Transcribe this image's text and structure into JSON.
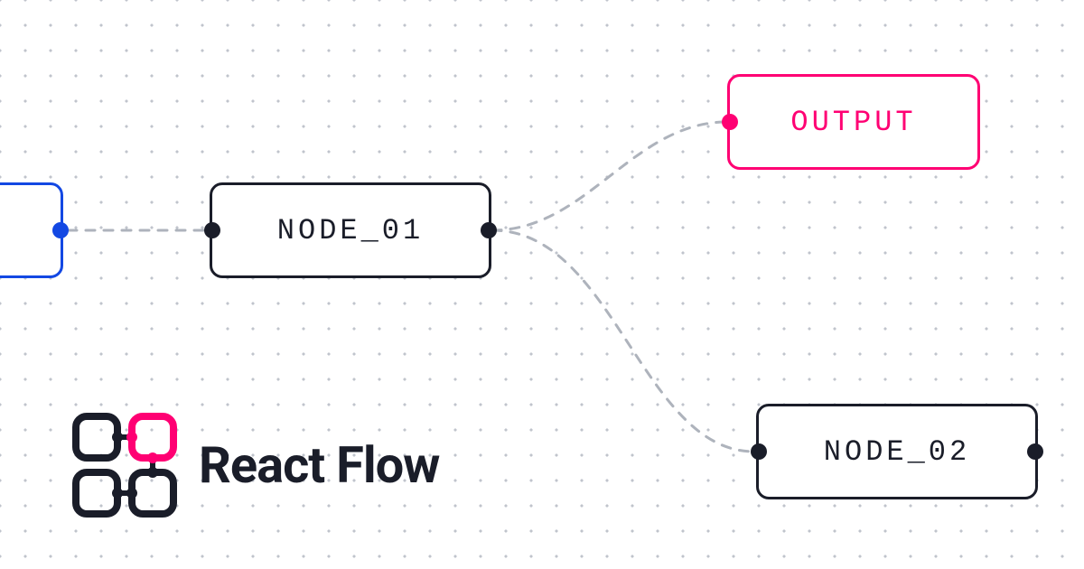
{
  "brand": {
    "label": "React Flow"
  },
  "colors": {
    "dark": "#1a1d29",
    "blue": "#1348e3",
    "pink": "#ff0073",
    "edge": "#aeb3bc"
  },
  "nodes": {
    "input": {
      "label": "",
      "color_key": "blue"
    },
    "node01": {
      "label": "NODE_01",
      "color_key": "dark"
    },
    "output": {
      "label": "OUTPUT",
      "color_key": "pink"
    },
    "node02": {
      "label": "NODE_02",
      "color_key": "dark"
    }
  },
  "edges": [
    {
      "from": "input",
      "to": "node01"
    },
    {
      "from": "node01",
      "to": "output"
    },
    {
      "from": "node01",
      "to": "node02"
    }
  ]
}
